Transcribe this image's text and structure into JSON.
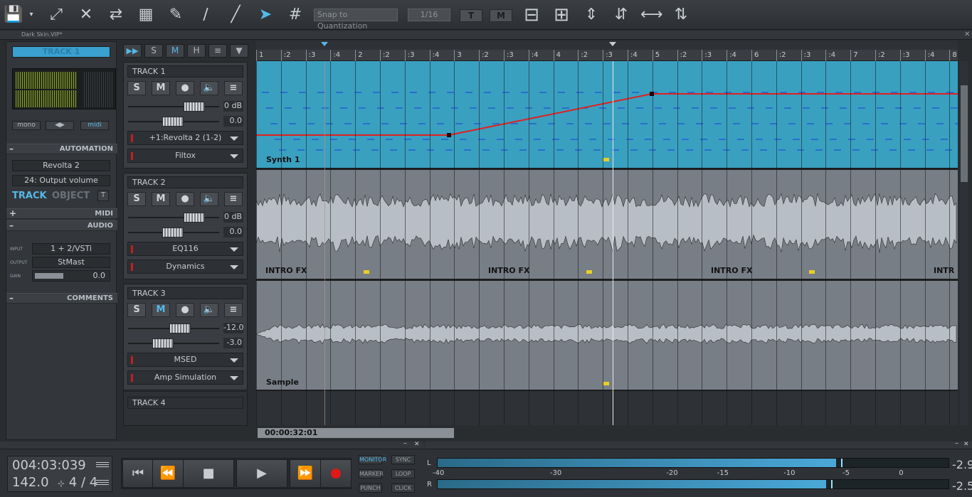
{
  "toolbar": {
    "snap_label": "Snap to Quantization",
    "quantize_value": "1/16",
    "icons": [
      "save-icon",
      "crossfade-icon",
      "delete-icon",
      "split-icon",
      "grid-icon",
      "draw-icon",
      "line-icon",
      "knife-icon",
      "pointer-icon",
      "quantize-icon",
      "T",
      "M",
      "zoom-out-icon",
      "zoom-in-icon",
      "expand-icon",
      "compress-icon",
      "fit-h-icon",
      "fit-v-icon"
    ]
  },
  "titlebar": {
    "title": "Dark Skin.VIP*"
  },
  "left": {
    "track_label": "TRACK 1",
    "mono": "mono",
    "midi": "midi",
    "automation": "AUTOMATION",
    "auto_plugin": "Revolta 2",
    "auto_param": "24: Output volume",
    "track_tab": "TRACK",
    "object_tab": "OBJECT",
    "t_btn": "T",
    "midi_section": "MIDI",
    "audio_section": "AUDIO",
    "input_label": "INPUT",
    "input_value": "1 + 2/VSTi",
    "output_label": "OUTPUT",
    "output_value": "StMast",
    "gain_label": "GAIN",
    "gain_value": "0.0",
    "comments": "COMMENTS"
  },
  "header_buttons": {
    "s": "S",
    "m": "M",
    "h": "H"
  },
  "tracks": [
    {
      "name": "TRACK 1",
      "vol": "0 dB",
      "pan": "0.0",
      "fx1": "+1:Revolta 2 (1-2)",
      "fx2": "Filtox",
      "clip": "Synth 1"
    },
    {
      "name": "TRACK 2",
      "vol": "0 dB",
      "pan": "0.0",
      "fx1": "EQ116",
      "fx2": "Dynamics",
      "clip": "INTRO FX"
    },
    {
      "name": "TRACK 3",
      "vol": "-12.0",
      "pan": "-3.0",
      "fx1": "MSED",
      "fx2": "Amp Simulation",
      "clip": "Sample"
    },
    {
      "name": "TRACK 4"
    }
  ],
  "ruler_labels": [
    "1",
    ":2",
    ":3",
    ":4",
    "2",
    ":2",
    ":3",
    ":4",
    "3",
    ":2",
    ":3",
    ":4",
    "4",
    ":2",
    ":3",
    ":4",
    "5",
    ":2",
    ":3",
    ":4",
    "6",
    ":2",
    ":3",
    ":4",
    "7",
    ":2",
    ":3",
    ":4",
    "8"
  ],
  "clips2": [
    "INTRO FX",
    "INTRO FX",
    "INTRO FX",
    "INTR"
  ],
  "scroll_time": "00:00:32:01",
  "transport": {
    "position": "004:03:039",
    "tempo": "142.0",
    "signature": "4 / 4",
    "monitor": "MONITOR",
    "sync": "SYNC",
    "marker": "MARKER",
    "loop": "LOOP",
    "punch": "PUNCH",
    "click": "CLICK"
  },
  "meters": {
    "left_label": "L",
    "right_label": "R",
    "left_peak": "-2.9",
    "right_peak": "-2.5",
    "left_level": 0.78,
    "right_level": 0.76,
    "scale": [
      "-40",
      "-30",
      "-20",
      "-15",
      "-10",
      "-5",
      "0"
    ]
  },
  "colors": {
    "accent": "#55b8e8",
    "clip_blue": "#3aa0c0",
    "record": "#e01818",
    "automation": "#e02020"
  }
}
